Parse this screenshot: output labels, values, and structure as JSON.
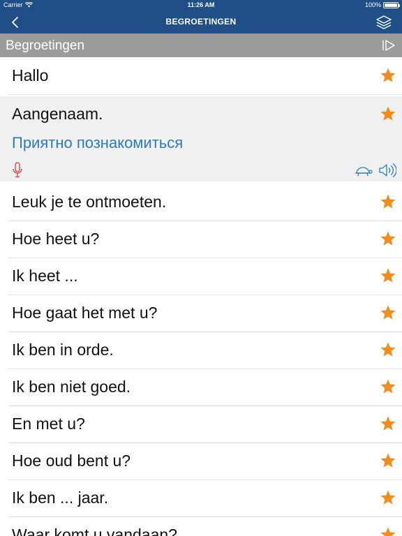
{
  "status": {
    "carrier": "Carrier",
    "time": "11:26 AM",
    "battery": "100%",
    "battery_level": 1.0
  },
  "nav": {
    "title": "BEGROETINGEN",
    "back_icon": "chevron-left-icon",
    "layers_icon": "layers-icon"
  },
  "section": {
    "title": "Begroetingen",
    "play_icon": "play-all-icon"
  },
  "colors": {
    "nav_bg": "#1f4f86",
    "header_bg": "#9b9b9b",
    "star": "#f28c1f",
    "translation": "#2b7bbd",
    "mic": "#d9413b",
    "expanded_bg": "#f0f0f1"
  },
  "phrases": [
    {
      "text": "Hallo",
      "favorite": true
    },
    {
      "text": "Aangenaam.",
      "translation": "Приятно познакомиться",
      "favorite": true,
      "expanded": true
    },
    {
      "text": "Leuk je te ontmoeten.",
      "favorite": true
    },
    {
      "text": "Hoe heet u?",
      "favorite": true
    },
    {
      "text": "Ik heet ...",
      "favorite": true
    },
    {
      "text": "Hoe gaat het met u?",
      "favorite": true
    },
    {
      "text": "Ik ben in orde.",
      "favorite": true
    },
    {
      "text": "Ik ben niet goed.",
      "favorite": true
    },
    {
      "text": "En met u?",
      "favorite": true
    },
    {
      "text": "Hoe oud bent u?",
      "favorite": true
    },
    {
      "text": "Ik ben ... jaar.",
      "favorite": true
    },
    {
      "text": "Waar komt u vandaan?",
      "favorite": true
    }
  ]
}
